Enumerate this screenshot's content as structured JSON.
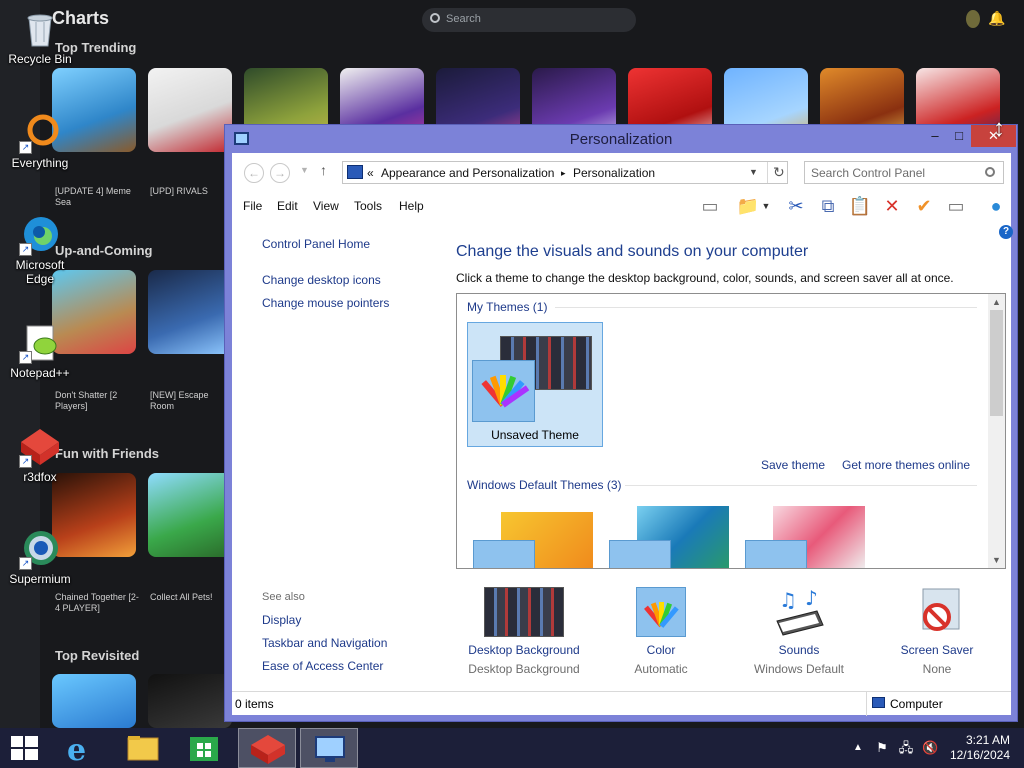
{
  "background_app": {
    "title": "Charts",
    "search_placeholder": "Search",
    "sections": [
      "Top Trending",
      "Up-and-Coming",
      "Fun with Friends",
      "Top Revisited"
    ],
    "captions": [
      "[UPDATE 4] Meme Sea",
      "[UPD] RIVALS",
      "Don't Shatter [2 Players]",
      "[NEW] Escape Room",
      "Chained Together [2-4 PLAYER]",
      "Collect All Pets!"
    ]
  },
  "desktop": {
    "icons": [
      {
        "label": "Recycle Bin"
      },
      {
        "label": "Everything"
      },
      {
        "label": "Microsoft Edge"
      },
      {
        "label": "Notepad++"
      },
      {
        "label": "r3dfox"
      },
      {
        "label": "Supermium"
      }
    ]
  },
  "window": {
    "title": "Personalization",
    "controls": {
      "minimize": "–",
      "maximize": "□",
      "close": "✕"
    },
    "address": {
      "prefix": "«",
      "crumb_1": "Appearance and Personalization",
      "separator": "▸",
      "crumb_2": "Personalization"
    },
    "search": {
      "placeholder": "Search Control Panel"
    },
    "menu": [
      "File",
      "Edit",
      "View",
      "Tools",
      "Help"
    ],
    "left_pane": {
      "home": "Control Panel Home",
      "links": [
        "Change desktop icons",
        "Change mouse pointers"
      ],
      "see_also_label": "See also",
      "see_also": [
        "Display",
        "Taskbar and Navigation",
        "Ease of Access Center"
      ]
    },
    "heading": "Change the visuals and sounds on your computer",
    "subtext": "Click a theme to change the desktop background, color, sounds, and screen saver all at once.",
    "my_themes": {
      "label": "My Themes (1)",
      "theme_name": "Unsaved Theme",
      "save_theme": "Save theme",
      "get_more": "Get more themes online"
    },
    "default_themes": {
      "label": "Windows Default Themes (3)"
    },
    "bottom_items": [
      {
        "label": "Desktop Background",
        "sub": "Desktop Background"
      },
      {
        "label": "Color",
        "sub": "Automatic"
      },
      {
        "label": "Sounds",
        "sub": "Windows Default"
      },
      {
        "label": "Screen Saver",
        "sub": "None"
      }
    ],
    "status": {
      "items": "0 items",
      "location": "Computer"
    }
  },
  "taskbar": {
    "time": "3:21 AM",
    "date": "12/16/2024"
  },
  "colors": {
    "window_frame": "#7c82d8",
    "link": "#1e3a8a",
    "heading": "#1e3f8f",
    "close_button": "#c7423d",
    "selected_theme": "#cce4f7"
  }
}
